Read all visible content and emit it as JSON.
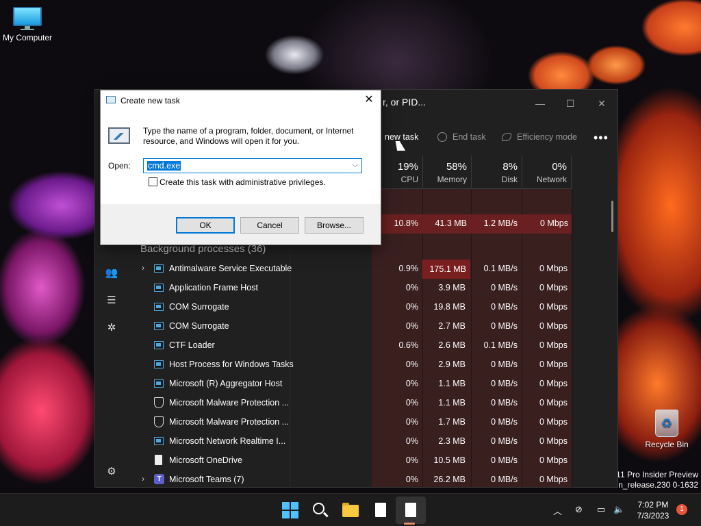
{
  "desktop": {
    "my_computer_label": "My Computer",
    "recycle_bin_label": "Recycle Bin",
    "watermark_line1": "11 Pro Insider Preview",
    "watermark_line2": "n_release.230 0-1632"
  },
  "task_manager": {
    "search_placeholder": "r, or PID...",
    "toolbar": {
      "new_task": "new task",
      "end_task": "End task",
      "efficiency_mode": "Efficiency mode",
      "more": "•••"
    },
    "columns": [
      {
        "pct": "19%",
        "label": "CPU"
      },
      {
        "pct": "58%",
        "label": "Memory"
      },
      {
        "pct": "8%",
        "label": "Disk"
      },
      {
        "pct": "0%",
        "label": "Network"
      }
    ],
    "top_row": {
      "cpu": "10.8%",
      "memory": "41.3 MB",
      "disk": "1.2 MB/s",
      "network": "0 Mbps"
    },
    "group_label": "Background processes (36)",
    "processes": [
      {
        "name": "Antimalware Service Executable",
        "icon": "app-icon",
        "expand": true,
        "cpu": "0.9%",
        "memory": "175.1 MB",
        "disk": "0.1 MB/s",
        "network": "0 Mbps",
        "mem_hot": true
      },
      {
        "name": "Application Frame Host",
        "icon": "app-icon",
        "expand": false,
        "cpu": "0%",
        "memory": "3.9 MB",
        "disk": "0 MB/s",
        "network": "0 Mbps"
      },
      {
        "name": "COM Surrogate",
        "icon": "app-icon",
        "expand": false,
        "cpu": "0%",
        "memory": "19.8 MB",
        "disk": "0 MB/s",
        "network": "0 Mbps"
      },
      {
        "name": "COM Surrogate",
        "icon": "app-icon",
        "expand": false,
        "cpu": "0%",
        "memory": "2.7 MB",
        "disk": "0 MB/s",
        "network": "0 Mbps"
      },
      {
        "name": "CTF Loader",
        "icon": "app-icon",
        "expand": false,
        "cpu": "0.6%",
        "memory": "2.6 MB",
        "disk": "0.1 MB/s",
        "network": "0 Mbps"
      },
      {
        "name": "Host Process for Windows Tasks",
        "icon": "app-icon",
        "expand": false,
        "cpu": "0%",
        "memory": "2.9 MB",
        "disk": "0 MB/s",
        "network": "0 Mbps"
      },
      {
        "name": "Microsoft (R) Aggregator Host",
        "icon": "app-icon",
        "expand": false,
        "cpu": "0%",
        "memory": "1.1 MB",
        "disk": "0 MB/s",
        "network": "0 Mbps"
      },
      {
        "name": "Microsoft Malware Protection ...",
        "icon": "shield-icon",
        "expand": false,
        "cpu": "0%",
        "memory": "1.1 MB",
        "disk": "0 MB/s",
        "network": "0 Mbps"
      },
      {
        "name": "Microsoft Malware Protection ...",
        "icon": "shield-icon",
        "expand": false,
        "cpu": "0%",
        "memory": "1.7 MB",
        "disk": "0 MB/s",
        "network": "0 Mbps"
      },
      {
        "name": "Microsoft Network Realtime I...",
        "icon": "app-icon",
        "expand": false,
        "cpu": "0%",
        "memory": "2.3 MB",
        "disk": "0 MB/s",
        "network": "0 Mbps"
      },
      {
        "name": "Microsoft OneDrive",
        "icon": "document-icon",
        "expand": false,
        "cpu": "0%",
        "memory": "10.5 MB",
        "disk": "0 MB/s",
        "network": "0 Mbps"
      },
      {
        "name": "Microsoft Teams (7)",
        "icon": "teams-icon",
        "expand": true,
        "cpu": "0%",
        "memory": "26.2 MB",
        "disk": "0 MB/s",
        "network": "0 Mbps"
      }
    ]
  },
  "run_dialog": {
    "title": "Create new task",
    "description": "Type the name of a program, folder, document, or Internet resource, and Windows will open it for you.",
    "open_label": "Open:",
    "open_value": "cmd.exe",
    "admin_checkbox_label": "Create this task with administrative privileges.",
    "ok_label": "OK",
    "cancel_label": "Cancel",
    "browse_label": "Browse..."
  },
  "taskbar": {
    "time": "7:02 PM",
    "date": "7/3/2023",
    "notification_count": "1"
  }
}
